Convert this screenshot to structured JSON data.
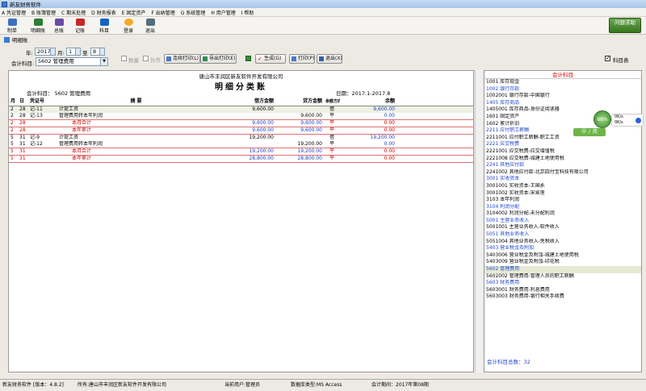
{
  "app": {
    "title": "新友财务软件"
  },
  "menu": [
    "A 凭证管理",
    "B 账簿管理",
    "C 期末处理",
    "D 财务报表",
    "E 固定资产",
    "F 出纳管理",
    "G 系统管理",
    "H 用户管理",
    "I 帮助"
  ],
  "toolbar": {
    "buttons": [
      {
        "label": "制单",
        "color": "#3c6fc4"
      },
      {
        "label": "明细账",
        "color": "#2e7d32"
      },
      {
        "label": "总账",
        "color": "#6a4ca6"
      },
      {
        "label": "记账",
        "color": "#c62828"
      },
      {
        "label": "科目",
        "color": "#1565c0"
      },
      {
        "label": "登录",
        "color": "#f9a825"
      },
      {
        "label": "退出",
        "color": "#546e7a"
      }
    ],
    "help": "问题求助"
  },
  "window": {
    "title": "明细账"
  },
  "controls": {
    "year_label": "年:",
    "year": "2017",
    "month_label": "月:",
    "month_from": "1",
    "to_label": "至",
    "month_to": "8",
    "account_label": "会计科目:",
    "account": "5602 管理费用",
    "qty_label": "数量",
    "fx_label": "外币",
    "btn_print_cont": "连续打印(L)",
    "btn_export": "导出打印(E)",
    "btn_generate": "生成(G)",
    "btn_print": "打印(P)",
    "btn_exit": "退出(X)",
    "chart_of_accounts_label": "科目表"
  },
  "ledger": {
    "company": "唐山市丰润区新友软件开发有限公司",
    "title": "明细分类账",
    "account_line": "会计科目： 5602 管理费用",
    "date_line": "日期：2017.1-2017.8",
    "headers": [
      "月",
      "日",
      "凭证号",
      "摘  要",
      "借方金额",
      "贷方金额",
      "余额方向",
      "余额"
    ],
    "rows": [
      {
        "m": "2",
        "d": "28",
        "v": "记-11",
        "s": "计提工资",
        "dr": "9,600.00",
        "cr": "",
        "dir": "借",
        "bal": "9,600.00",
        "cls": "hl"
      },
      {
        "m": "2",
        "d": "28",
        "v": "记-13",
        "s": "管理费用转本年利润",
        "dr": "",
        "cr": "9,600.00",
        "dir": "平",
        "bal": "0.00",
        "cls": ""
      },
      {
        "m": "2",
        "d": "28",
        "v": "",
        "s": "本月合计",
        "dr": "9,600.00",
        "cr": "9,600.00",
        "dir": "平",
        "bal": "0.00",
        "cls": "red"
      },
      {
        "m": "2",
        "d": "28",
        "v": "",
        "s": "本年累计",
        "dr": "9,600.00",
        "cr": "9,600.00",
        "dir": "平",
        "bal": "0.00",
        "cls": "red"
      },
      {
        "m": "5",
        "d": "31",
        "v": "记-9",
        "s": "计提工资",
        "dr": "19,200.00",
        "cr": "",
        "dir": "借",
        "bal": "19,200.00",
        "cls": ""
      },
      {
        "m": "5",
        "d": "31",
        "v": "记-12",
        "s": "管理费用转本年利润",
        "dr": "",
        "cr": "19,200.00",
        "dir": "平",
        "bal": "0.00",
        "cls": ""
      },
      {
        "m": "5",
        "d": "31",
        "v": "",
        "s": "本月合计",
        "dr": "19,200.00",
        "cr": "19,200.00",
        "dir": "平",
        "bal": "0.00",
        "cls": "red"
      },
      {
        "m": "5",
        "d": "31",
        "v": "",
        "s": "本年累计",
        "dr": "28,800.00",
        "cr": "28,800.00",
        "dir": "平",
        "bal": "0.00",
        "cls": "red"
      }
    ]
  },
  "accounts": {
    "header": "会计科目",
    "items": [
      {
        "t": "1001 库存现金",
        "c": ""
      },
      {
        "t": "1002 银行存款",
        "c": "blue"
      },
      {
        "t": "1002001 银行存款-中国银行",
        "c": ""
      },
      {
        "t": "1405 库存商品",
        "c": "blue"
      },
      {
        "t": "1405001 库存商品-身份证阅读器",
        "c": ""
      },
      {
        "t": "1601 固定资产",
        "c": ""
      },
      {
        "t": "1602 累计折旧",
        "c": ""
      },
      {
        "t": "2211 应付职工薪酬",
        "c": "blue"
      },
      {
        "t": "2211001 应付职工薪酬-职工工资",
        "c": ""
      },
      {
        "t": "2221 应交税费",
        "c": "blue"
      },
      {
        "t": "2221001 应交税费-应交增值税",
        "c": ""
      },
      {
        "t": "2221008 应交税费-城建土地使用税",
        "c": ""
      },
      {
        "t": "2241 其他应付款",
        "c": "blue"
      },
      {
        "t": "2241002 其他应付款-北京四付宝科技有限公司",
        "c": ""
      },
      {
        "t": "3001 实收资本",
        "c": "blue"
      },
      {
        "t": "3001001 实收资本-王国永",
        "c": ""
      },
      {
        "t": "3001002 实收资本-宋翠莲",
        "c": ""
      },
      {
        "t": "3103 本年利润",
        "c": ""
      },
      {
        "t": "3104 利润分配",
        "c": "blue"
      },
      {
        "t": "3104002 利润分配-未分配利润",
        "c": ""
      },
      {
        "t": "5001 主营业务收入",
        "c": "blue"
      },
      {
        "t": "5001001 主营业务收入-软件收入",
        "c": ""
      },
      {
        "t": "5051 其他业务收入",
        "c": "blue"
      },
      {
        "t": "5051004 其他业务收入-免税收入",
        "c": ""
      },
      {
        "t": "5403 营业税金及附加",
        "c": "blue"
      },
      {
        "t": "5403006 营业税金及附加-城建土地使用税",
        "c": ""
      },
      {
        "t": "5403009 营业税金及附加-印花税",
        "c": ""
      },
      {
        "t": "5602 管理费用",
        "c": "blue sel"
      },
      {
        "t": "5602002 管理费用-管理人员的职工薪酬",
        "c": ""
      },
      {
        "t": "5603 财务费用",
        "c": "blue"
      },
      {
        "t": "5603001 财务费用-利息费用",
        "c": ""
      },
      {
        "t": "5603003 财务费用-银行相关手续费",
        "c": ""
      }
    ],
    "count": "会计科目总数：32"
  },
  "float": {
    "percent": "88%",
    "net1": "0K/s",
    "net2": "0K/s",
    "ime": "中 ♪ 简"
  },
  "status": {
    "s1": "新友财务软件 [版本：4.8.2]",
    "s2": "所有:唐山市丰润区新友软件开发有限公司",
    "s3": "当前用户:管理员",
    "s4": "数据库类型:MS Access",
    "s5": "会计期间：2017年第08期"
  }
}
